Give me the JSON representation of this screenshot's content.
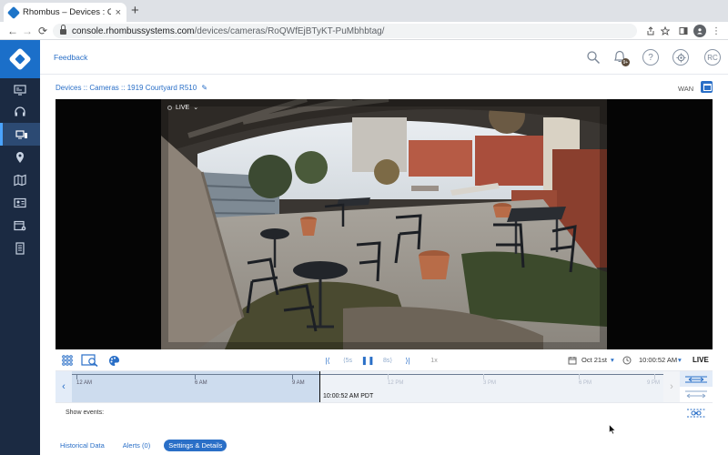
{
  "browser": {
    "tab_title": "Rhombus – Devices : Cameras",
    "tab_close": "×",
    "new_tab": "+",
    "url_host": "console.rhombussystems.com",
    "url_path": "/devices/cameras/RoQWfEjBTyKT-PuMbhbtag/",
    "back_glyph": "←",
    "forward_glyph": "→",
    "reload_glyph": "⟳",
    "icons": [
      "share-icon",
      "star-icon",
      "sidebar-icon",
      "profile-icon",
      "menu-icon"
    ],
    "menu_glyph": "⋮"
  },
  "header": {
    "feedback": "Feedback",
    "user_initials": "RC",
    "help_glyph": "?",
    "bell_badge": "9+"
  },
  "sidebar": {
    "items": [
      {
        "name": "dashboard",
        "icon": "monitor-icon"
      },
      {
        "name": "support",
        "icon": "headset-icon"
      },
      {
        "name": "devices",
        "icon": "devices-icon",
        "active": true
      },
      {
        "name": "locations",
        "icon": "map-pin-icon"
      },
      {
        "name": "maps",
        "icon": "map-icon"
      },
      {
        "name": "people",
        "icon": "id-card-icon"
      },
      {
        "name": "schedules",
        "icon": "calendar-gear-icon"
      },
      {
        "name": "reports",
        "icon": "document-icon"
      }
    ]
  },
  "breadcrumb": {
    "devices": "Devices",
    "sep1": " :: ",
    "cameras": "Cameras",
    "sep2": " :: ",
    "current": "1919 Courtyard R510"
  },
  "network": {
    "label": "WAN"
  },
  "video": {
    "live_badge": "LIVE",
    "live_chevron": "⌄"
  },
  "controls": {
    "skip_back": "|⟨",
    "back_5": "⟨5s",
    "pause": "❚❚",
    "forward_8": "8s⟩",
    "skip_forward": "⟩|",
    "speed": "1x",
    "date": "Oct 21st",
    "time": "10:00:52 AM",
    "live": "LIVE",
    "dropdown_glyph": "▾"
  },
  "timeline": {
    "ticks": [
      "12 AM",
      "6 AM",
      "9 AM",
      "12 PM",
      "3 PM",
      "6 PM",
      "9 PM"
    ],
    "cursor_time": "10:00:52 AM PDT",
    "left_arrow": "‹",
    "right_arrow": "›"
  },
  "events": {
    "label": "Show events:"
  },
  "tabs": {
    "historical": "Historical Data",
    "alerts": "Alerts (0)",
    "settings": "Settings & Details"
  }
}
